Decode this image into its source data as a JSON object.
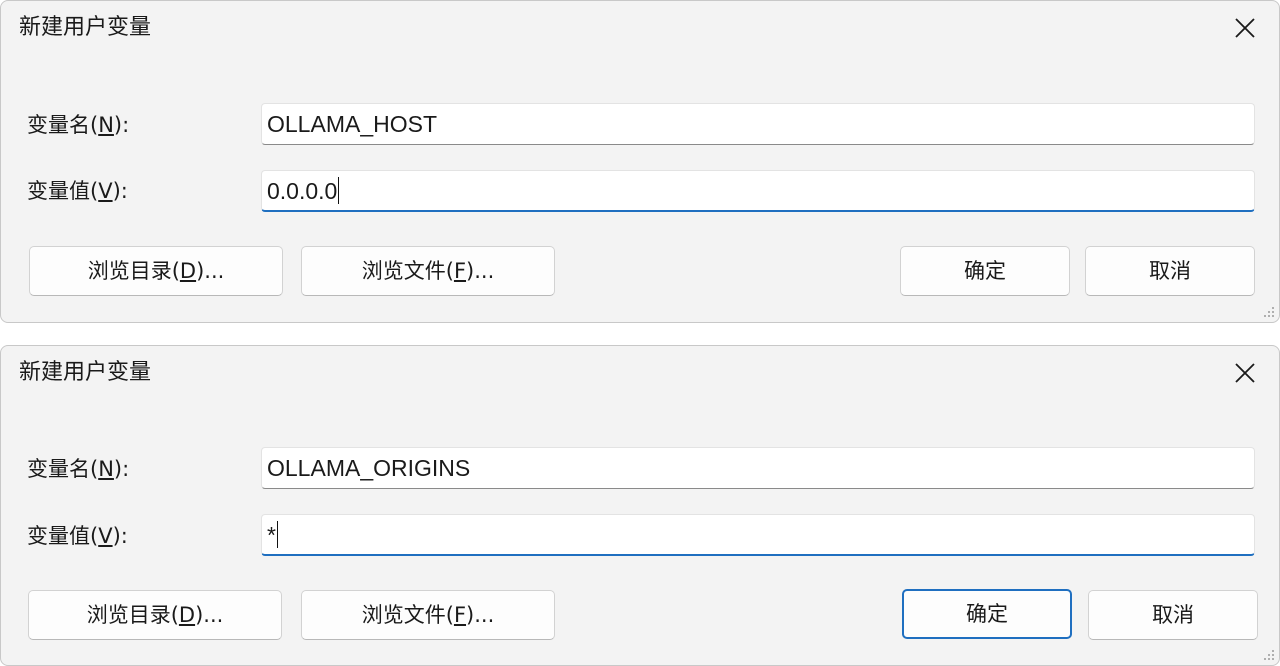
{
  "dialogs": [
    {
      "title": "新建用户变量",
      "name_label": {
        "prefix": "变量名(",
        "mnemonic": "N",
        "suffix": "):"
      },
      "value_label": {
        "prefix": "变量值(",
        "mnemonic": "V",
        "suffix": "):"
      },
      "name_value": "OLLAMA_HOST",
      "value_value": "0.0.0.0",
      "browse_dir": {
        "prefix": "浏览目录(",
        "mnemonic": "D",
        "suffix": ")..."
      },
      "browse_file": {
        "prefix": "浏览文件(",
        "mnemonic": "F",
        "suffix": ")..."
      },
      "ok_label": "确定",
      "cancel_label": "取消"
    },
    {
      "title": "新建用户变量",
      "name_label": {
        "prefix": "变量名(",
        "mnemonic": "N",
        "suffix": "):"
      },
      "value_label": {
        "prefix": "变量值(",
        "mnemonic": "V",
        "suffix": "):"
      },
      "name_value": "OLLAMA_ORIGINS",
      "value_value": "*",
      "browse_dir": {
        "prefix": "浏览目录(",
        "mnemonic": "D",
        "suffix": ")..."
      },
      "browse_file": {
        "prefix": "浏览文件(",
        "mnemonic": "F",
        "suffix": ")..."
      },
      "ok_label": "确定",
      "cancel_label": "取消"
    }
  ],
  "colors": {
    "accent": "#1f6fc0",
    "dialog_background": "#f3f3f3",
    "input_background": "#ffffff"
  },
  "icons": {
    "close": "close-icon",
    "resize": "resize-grip-icon"
  }
}
